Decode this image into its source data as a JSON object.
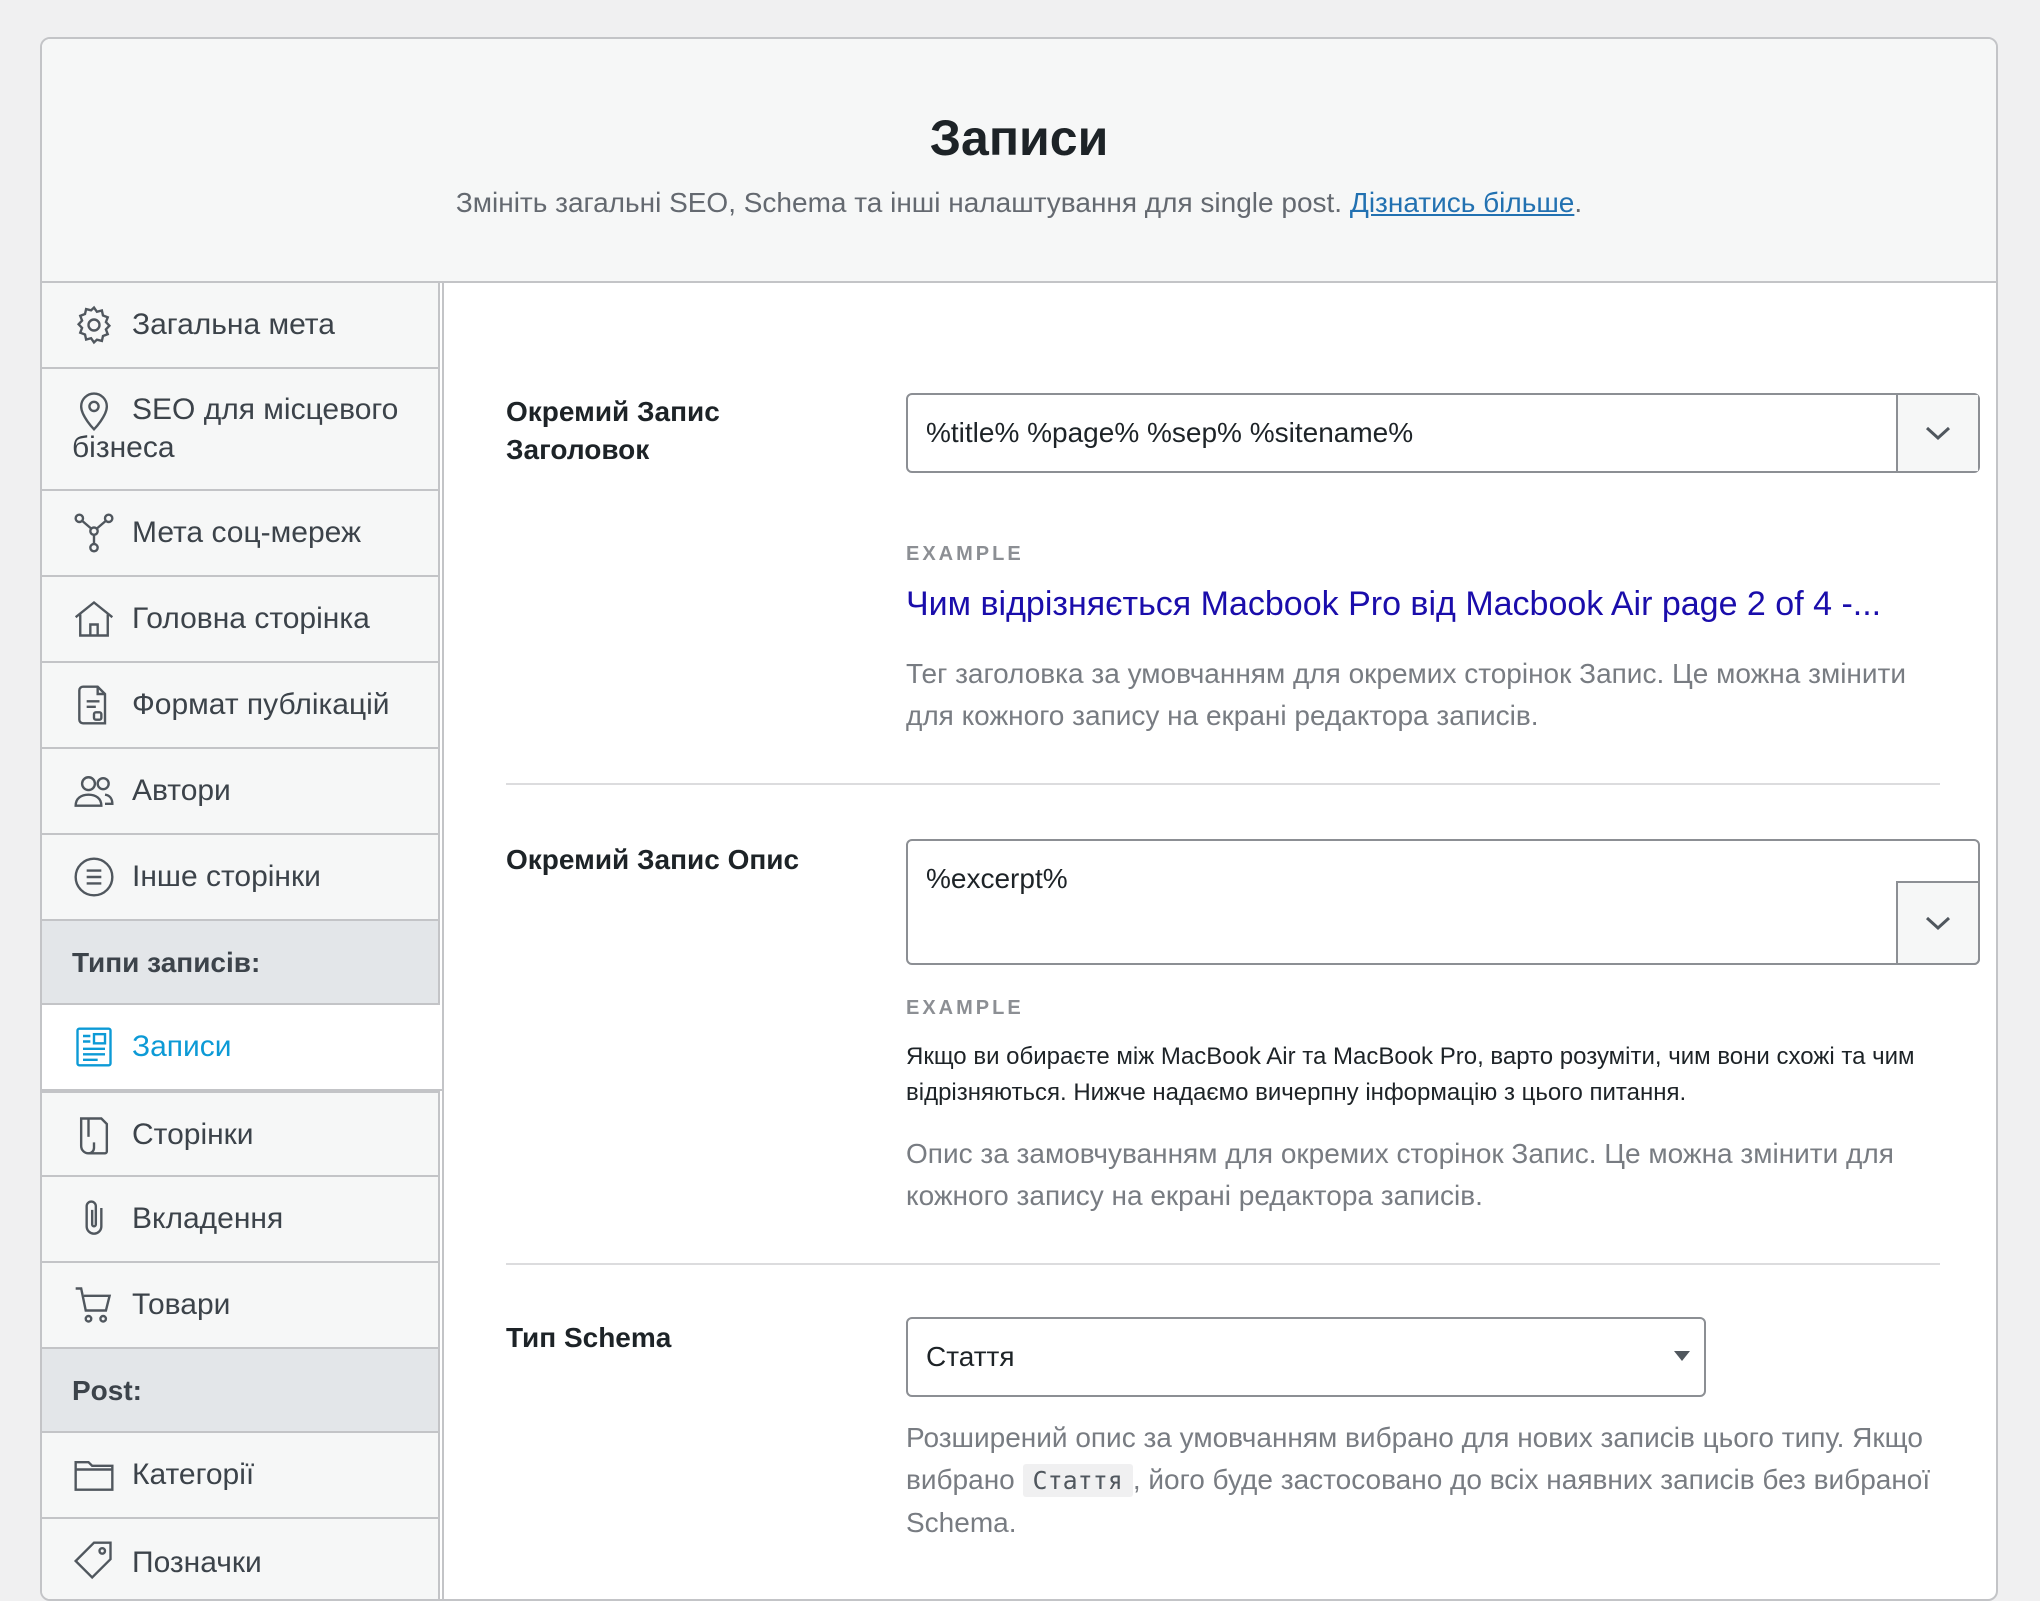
{
  "header": {
    "title": "Записи",
    "description": "Змініть загальні SEO, Schema та інші налаштування для single post.",
    "learn_more": "Дізнатись більше",
    "period": "."
  },
  "sidebar": {
    "items": [
      {
        "label": "Загальна мета",
        "icon": "gear-icon"
      },
      {
        "label": "SEO для місцевого бізнеса",
        "icon": "location-pin-icon"
      },
      {
        "label": "Мета соц-мереж",
        "icon": "social-network-icon"
      },
      {
        "label": "Головна сторінка",
        "icon": "home-icon"
      },
      {
        "label": "Формат публікацій",
        "icon": "document-format-icon"
      },
      {
        "label": "Автори",
        "icon": "users-icon"
      },
      {
        "label": "Інше сторінки",
        "icon": "list-circle-icon"
      }
    ],
    "section_post_types": "Типи записів:",
    "post_types": [
      {
        "label": "Записи",
        "icon": "post-icon",
        "active": true
      },
      {
        "label": "Сторінки",
        "icon": "page-icon"
      },
      {
        "label": "Вкладення",
        "icon": "paperclip-icon"
      },
      {
        "label": "Товари",
        "icon": "cart-icon"
      }
    ],
    "section_post": "Post:",
    "taxonomies": [
      {
        "label": "Категорії",
        "icon": "folder-icon"
      },
      {
        "label": "Позначки",
        "icon": "tag-icon"
      }
    ]
  },
  "title_field": {
    "label": "Окремий Запис Заголовок",
    "value": "%title% %page% %sep% %sitename%",
    "example_label": "EXAMPLE",
    "example": "Чим відрізняється Macbook Pro від Macbook Air page 2 of 4 -...",
    "help": "Тег заголовка за умовчанням для окремих сторінок Запис. Це можна змінити для кожного запису на екрані редактора записів."
  },
  "desc_field": {
    "label": "Окремий Запис Опис",
    "value": "%excerpt%",
    "example_label": "EXAMPLE",
    "example": "Якщо ви обираєте між MacBook Air та MacBook Pro, варто розуміти, чим вони схожі та чим відрізняються. Нижче надаємо вичерпну інформацію з цього питання.",
    "help": "Опис за замовчуванням для окремих сторінок Запис. Це можна змінити для кожного запису на екрані редактора записів."
  },
  "schema_field": {
    "label": "Тип Schema",
    "selected": "Стаття",
    "help_part1": "Розширений опис за умовчанням вибрано для нових записів цього типу. Якщо вибрано ",
    "help_code": "Стаття",
    "help_part2": ", його буде застосовано до всіх наявних записів без вибраної Schema."
  },
  "colors": {
    "accent": "#0c9ad6",
    "link": "#2271b1",
    "example_link": "#1a0dab"
  }
}
